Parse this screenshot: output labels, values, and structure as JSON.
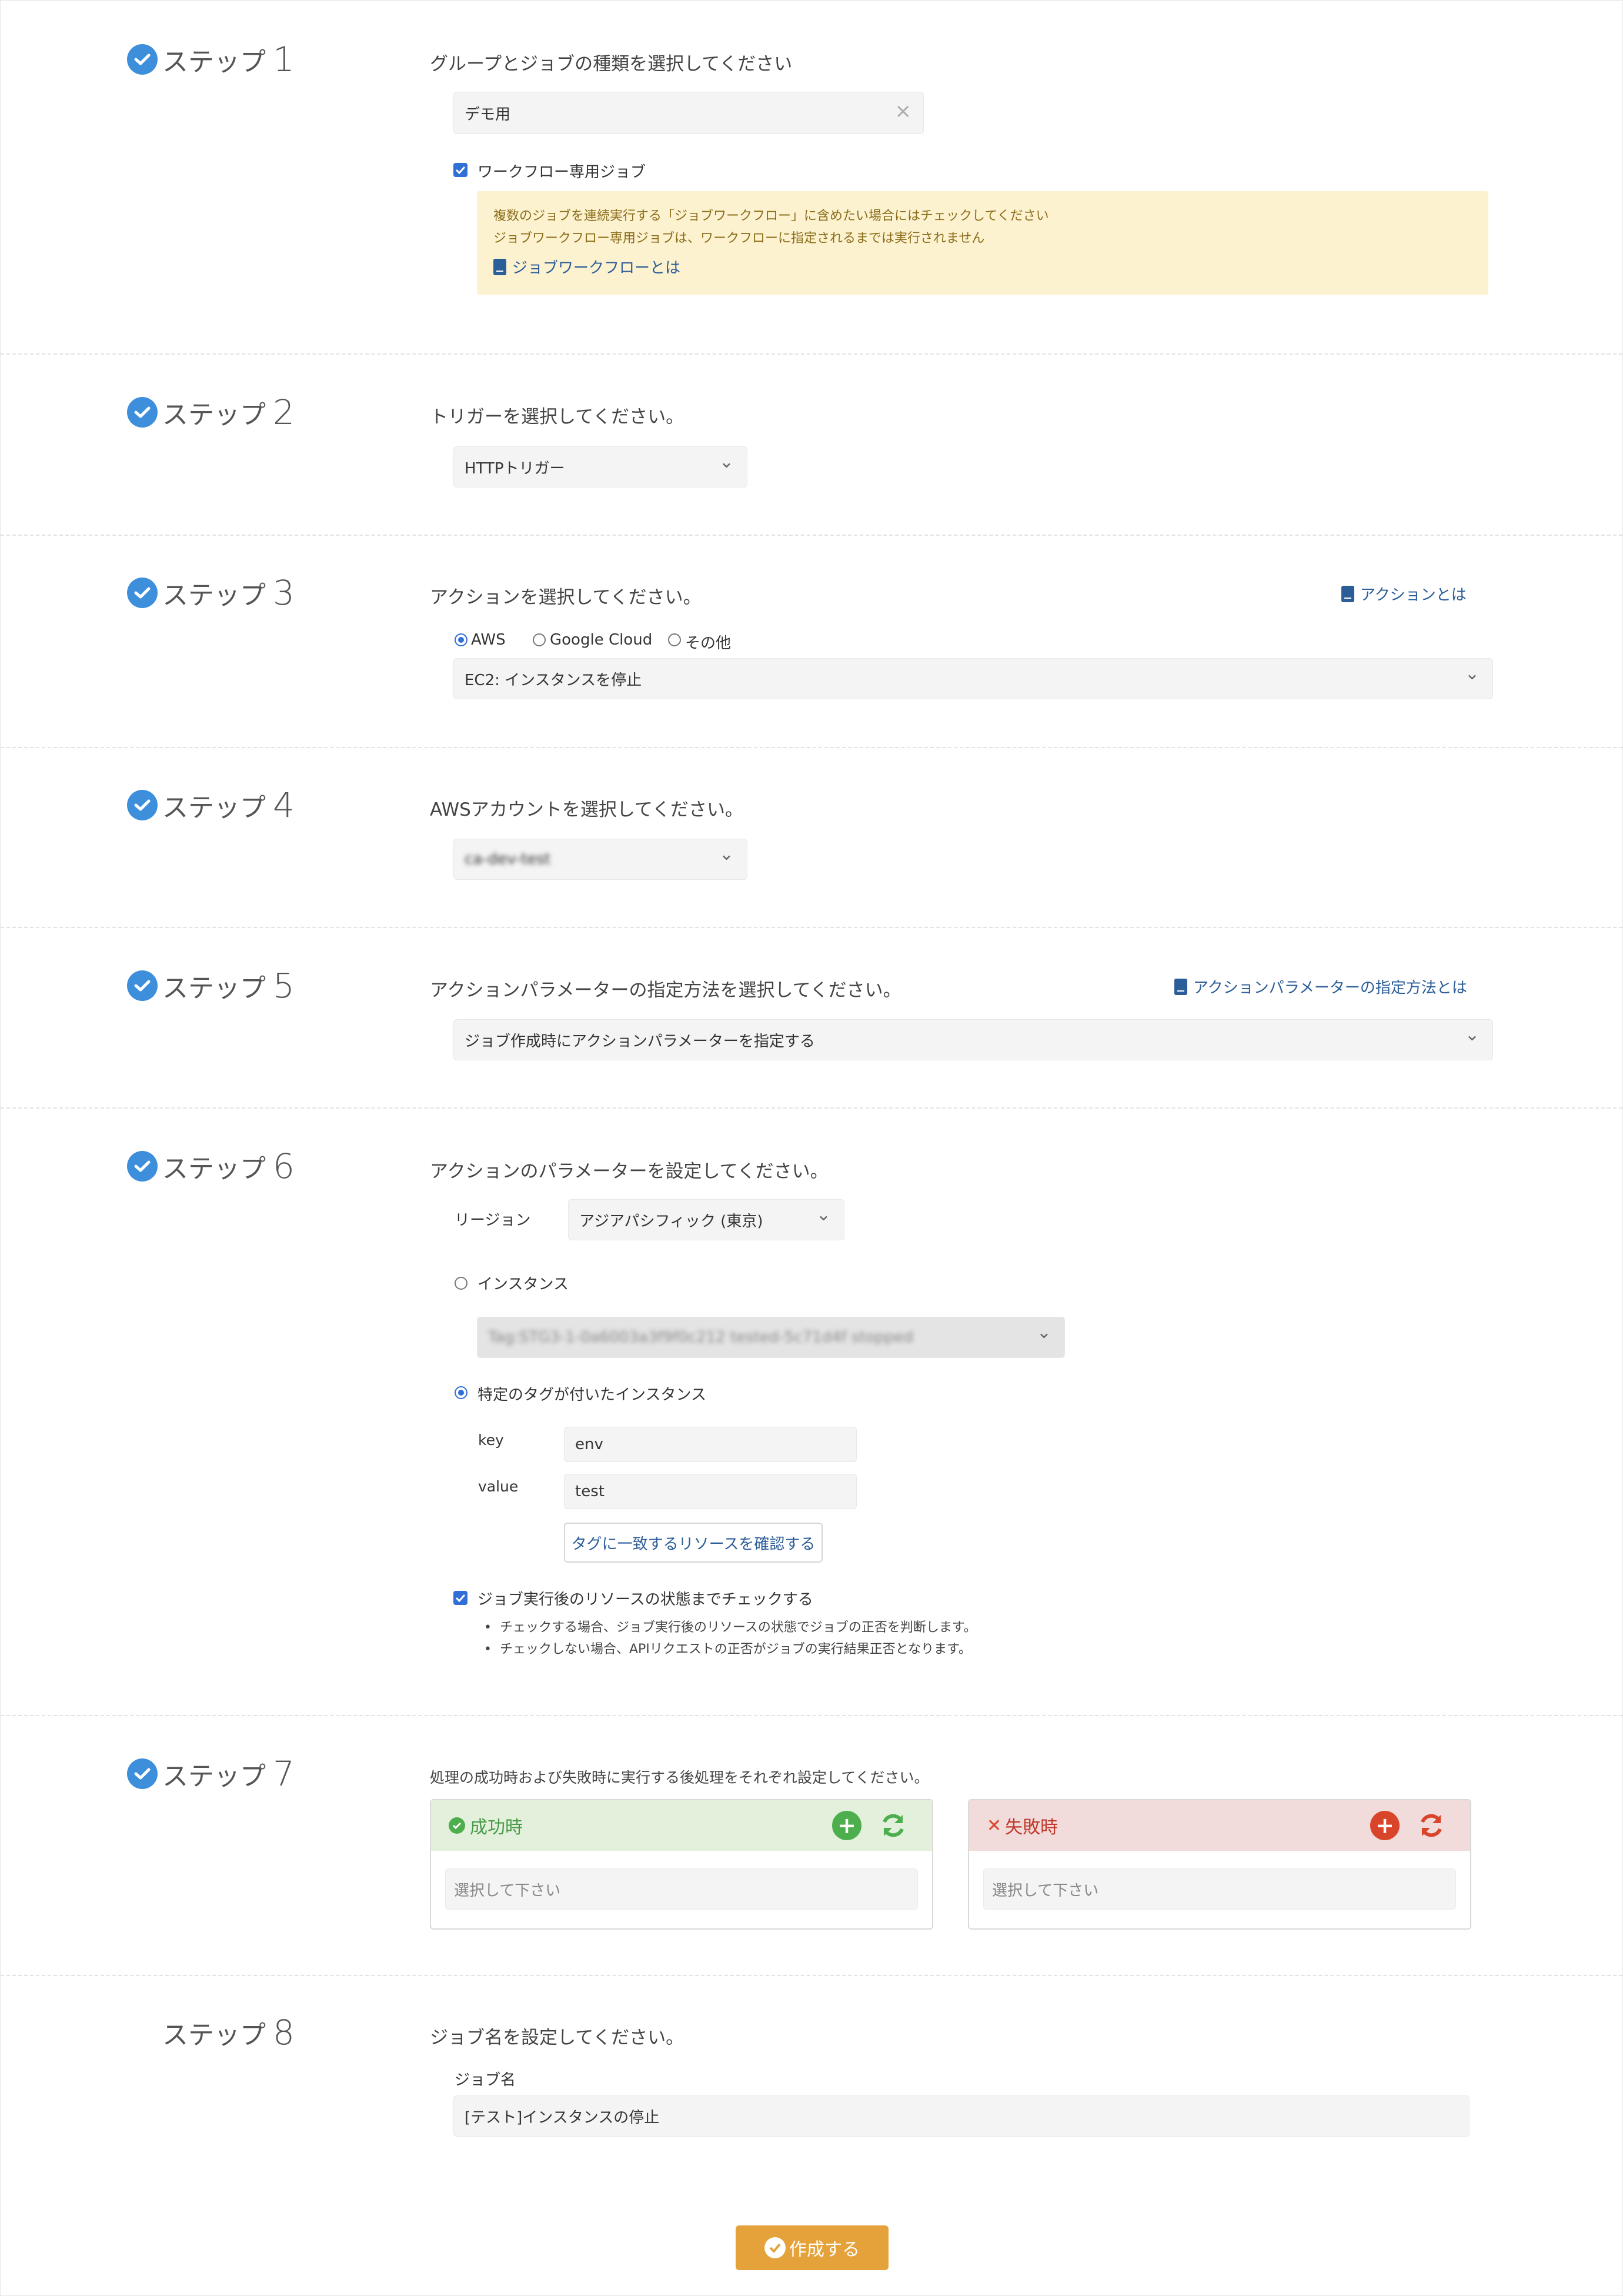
{
  "steps": [
    {
      "label": "ステップ",
      "num": "1",
      "question": "グループとジョブの種類を選択してください"
    },
    {
      "label": "ステップ",
      "num": "2",
      "question": "トリガーを選択してください。"
    },
    {
      "label": "ステップ",
      "num": "3",
      "question": "アクションを選択してください。"
    },
    {
      "label": "ステップ",
      "num": "4",
      "question": "AWSアカウントを選択してください。"
    },
    {
      "label": "ステップ",
      "num": "5",
      "question": "アクションパラメーターの指定方法を選択してください。"
    },
    {
      "label": "ステップ",
      "num": "6",
      "question": "アクションのパラメーターを設定してください。"
    },
    {
      "label": "ステップ",
      "num": "7",
      "question": "処理の成功時および失敗時に実行する後処理をそれぞれ設定してください。"
    },
    {
      "label": "ステップ",
      "num": "8",
      "question": "ジョブ名を設定してください。"
    }
  ],
  "step1": {
    "group_value": "デモ用",
    "clear_icon": "×",
    "workflow_checkbox_label": "ワークフロー専用ジョブ",
    "notice_line1": "複数のジョブを連続実行する「ジョブワークフロー」に含めたい場合にはチェックしてください",
    "notice_line2": "ジョブワークフロー専用ジョブは、ワークフローに指定されるまでは実行されません",
    "notice_link": "ジョブワークフローとは"
  },
  "step2": {
    "trigger_value": "HTTPトリガー"
  },
  "step3": {
    "help_link": "アクションとは",
    "radio_aws": "AWS",
    "radio_gcp": "Google Cloud",
    "radio_other": "その他",
    "action_value": "EC2: インスタンスを停止"
  },
  "step4": {
    "account_value": "ca-dev-test"
  },
  "step5": {
    "help_link": "アクションパラメーターの指定方法とは",
    "method_value": "ジョブ作成時にアクションパラメーターを指定する"
  },
  "step6": {
    "region_label": "リージョン",
    "region_value": "アジアパシフィック (東京)",
    "instance_radio_label": "インスタンス",
    "instance_value": "Tag:STG3-1-0a6003a3f9f0c212 tested-5c71d4f stopped",
    "tag_radio_label": "特定のタグが付いたインスタンス",
    "key_label": "key",
    "key_value": "env",
    "value_label": "value",
    "value_value": "test",
    "confirm_button": "タグに一致するリソースを確認する",
    "check_after_label": "ジョブ実行後のリソースの状態までチェックする",
    "bullet1": "チェックする場合、ジョブ実行後のリソースの状態でジョブの正否を判断します。",
    "bullet2": "チェックしない場合、APIリクエストの正否がジョブの実行結果正否となります。"
  },
  "step7": {
    "success_title": "成功時",
    "success_placeholder": "選択して下さい",
    "failure_title": "失敗時",
    "failure_placeholder": "選択して下さい",
    "add_symbol": "+"
  },
  "step8": {
    "job_name_label": "ジョブ名",
    "job_name_value": "[テスト]インスタンスの停止"
  },
  "create_button": "作成する",
  "colors": {
    "accent": "#3d8fdc",
    "link": "#2b5d98",
    "notice_bg": "#fdf2cf",
    "success": "#4cae4c",
    "danger": "#d9452b",
    "create": "#e5a23a"
  }
}
